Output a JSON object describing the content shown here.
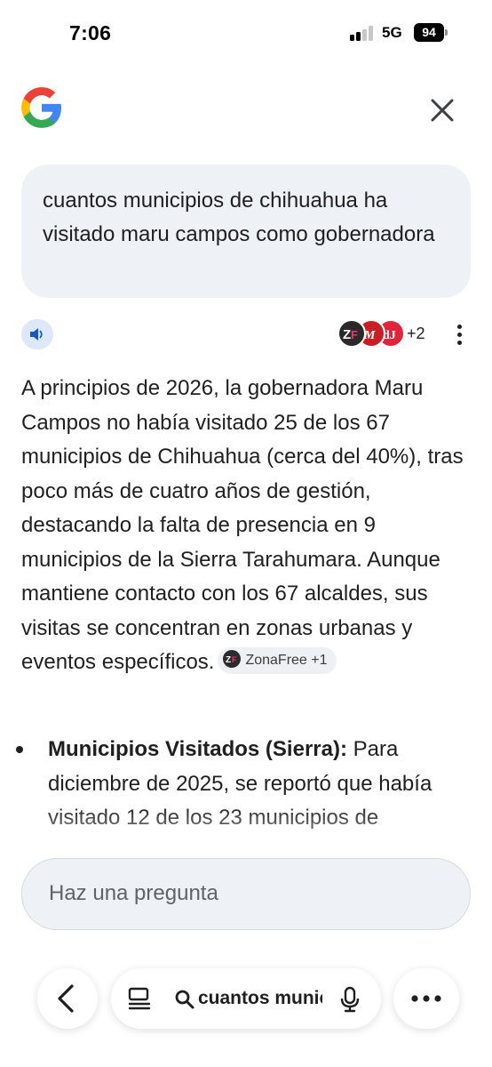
{
  "status_bar": {
    "time": "7:06",
    "network": "5G",
    "battery": "94"
  },
  "header": {
    "logo_icon": "google-g-logo",
    "close_icon": "close-icon"
  },
  "query": {
    "text": "cuantos municipios de chihuahua ha visitado maru campos como gobernadora"
  },
  "sources": {
    "more_count": "+2"
  },
  "answer": {
    "paragraph": "A principios de 2026, la gobernadora Maru Campos no había visitado 25 de los 67 municipios de Chihuahua (cerca del 40%), tras poco más de cuatro años de gestión, destacando la falta de presencia en 9 municipios de la Sierra Tarahumara. Aunque mantiene contacto con los 67 alcaldes, sus visitas se concentran en zonas urbanas y eventos específicos.",
    "citation_chip": "ZonaFree +1",
    "bullets": [
      {
        "title": "Municipios Visitados (Sierra):",
        "text": " Para diciembre de 2025, se reportó que había visitado 12 de los 23 municipios de"
      }
    ]
  },
  "ask": {
    "placeholder": "Haz una pregunta"
  },
  "bottom_bar": {
    "search_text": "cuantos municipios de chihuahua ha visitado maru campos como gobernadora"
  },
  "colors": {
    "bubble_bg": "#eef1f6",
    "speaker_bg": "#dfe8f9",
    "accent_blue": "#1a56c7"
  }
}
